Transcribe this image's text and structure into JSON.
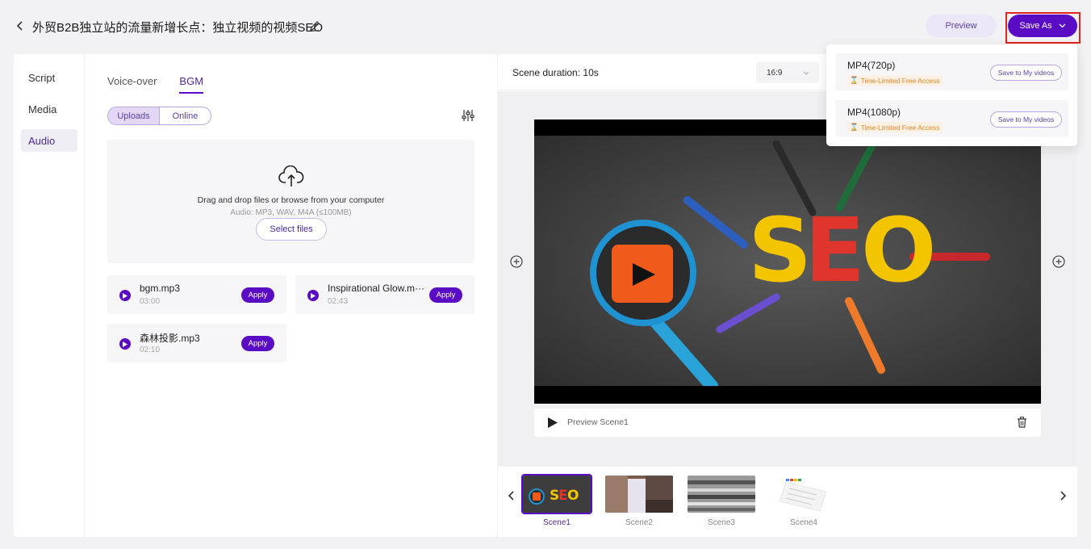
{
  "header": {
    "title": "外贸B2B独立站的流量新增长点：独立视频的视频SEO",
    "preview_label": "Preview",
    "saveas_label": "Save As"
  },
  "sidebar": {
    "items": [
      {
        "label": "Script",
        "active": false
      },
      {
        "label": "Media",
        "active": false
      },
      {
        "label": "Audio",
        "active": true
      }
    ]
  },
  "audio": {
    "tabs": [
      {
        "label": "Voice-over",
        "active": false
      },
      {
        "label": "BGM",
        "active": true
      }
    ],
    "source": {
      "uploads": "Uploads",
      "online": "Online"
    },
    "dropzone": {
      "main": "Drag and drop files or browse from your computer",
      "sub": "Audio: MP3, WAV, M4A (≤100MB)",
      "button": "Select files"
    },
    "tracks": [
      {
        "name": "bgm.mp3",
        "duration": "03:00",
        "apply": "Apply"
      },
      {
        "name": "Inspirational Glow.m···",
        "duration": "02:43",
        "apply": "Apply"
      },
      {
        "name": "森林投影.mp3",
        "duration": "02:10",
        "apply": "Apply"
      }
    ]
  },
  "editor": {
    "scene_duration": "Scene duration: 10s",
    "ratio": "16:9",
    "preview_scene": "Preview Scene1",
    "video_text": "SEO"
  },
  "filmstrip": {
    "scenes": [
      {
        "label": "Scene1",
        "active": true
      },
      {
        "label": "Scene2",
        "active": false
      },
      {
        "label": "Scene3",
        "active": false
      },
      {
        "label": "Scene4",
        "active": false
      }
    ]
  },
  "save_menu": {
    "items": [
      {
        "format": "MP4(720p)",
        "badge": "Time-Limited Free Access",
        "button": "Save to My videos"
      },
      {
        "format": "MP4(1080p)",
        "badge": "Time-Limited Free Access",
        "button": "Save to My videos"
      }
    ]
  },
  "colors": {
    "accent": "#5a0bc4",
    "highlight": "#e0231c",
    "badge": "#e8862a"
  }
}
